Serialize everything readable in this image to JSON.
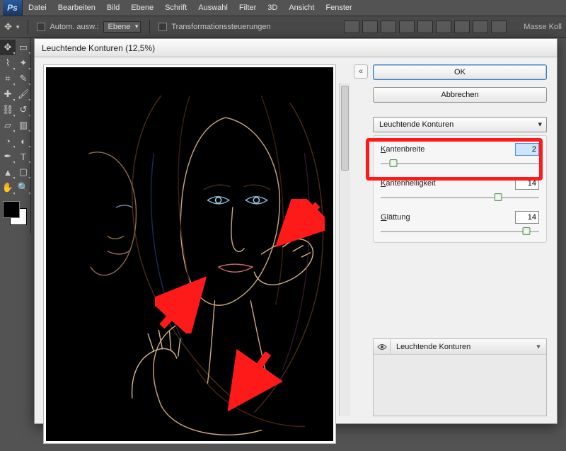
{
  "menubar": {
    "items": [
      "Datei",
      "Bearbeiten",
      "Bild",
      "Ebene",
      "Schrift",
      "Auswahl",
      "Filter",
      "3D",
      "Ansicht",
      "Fenster"
    ]
  },
  "optionsbar": {
    "auto_select_label": "Autom. ausw.:",
    "target_dd": "Ebene",
    "transform_cb_label": "Transformationssteuerungen",
    "right_label": "Masse Koll"
  },
  "dialog": {
    "title": "Leuchtende Konturen (12,5%)",
    "ok": "OK",
    "cancel": "Abbrechen",
    "filter_dd": "Leuchtende Konturen",
    "params": {
      "p1": {
        "label": "Kantenbreite",
        "underline": "K",
        "value": "2"
      },
      "p2": {
        "label": "Kantenhelligkeit",
        "underline": "K",
        "value": "14"
      },
      "p3": {
        "label": "Glättung",
        "underline": "G",
        "value": "14"
      }
    },
    "fx_item": "Leuchtende Konturen"
  }
}
